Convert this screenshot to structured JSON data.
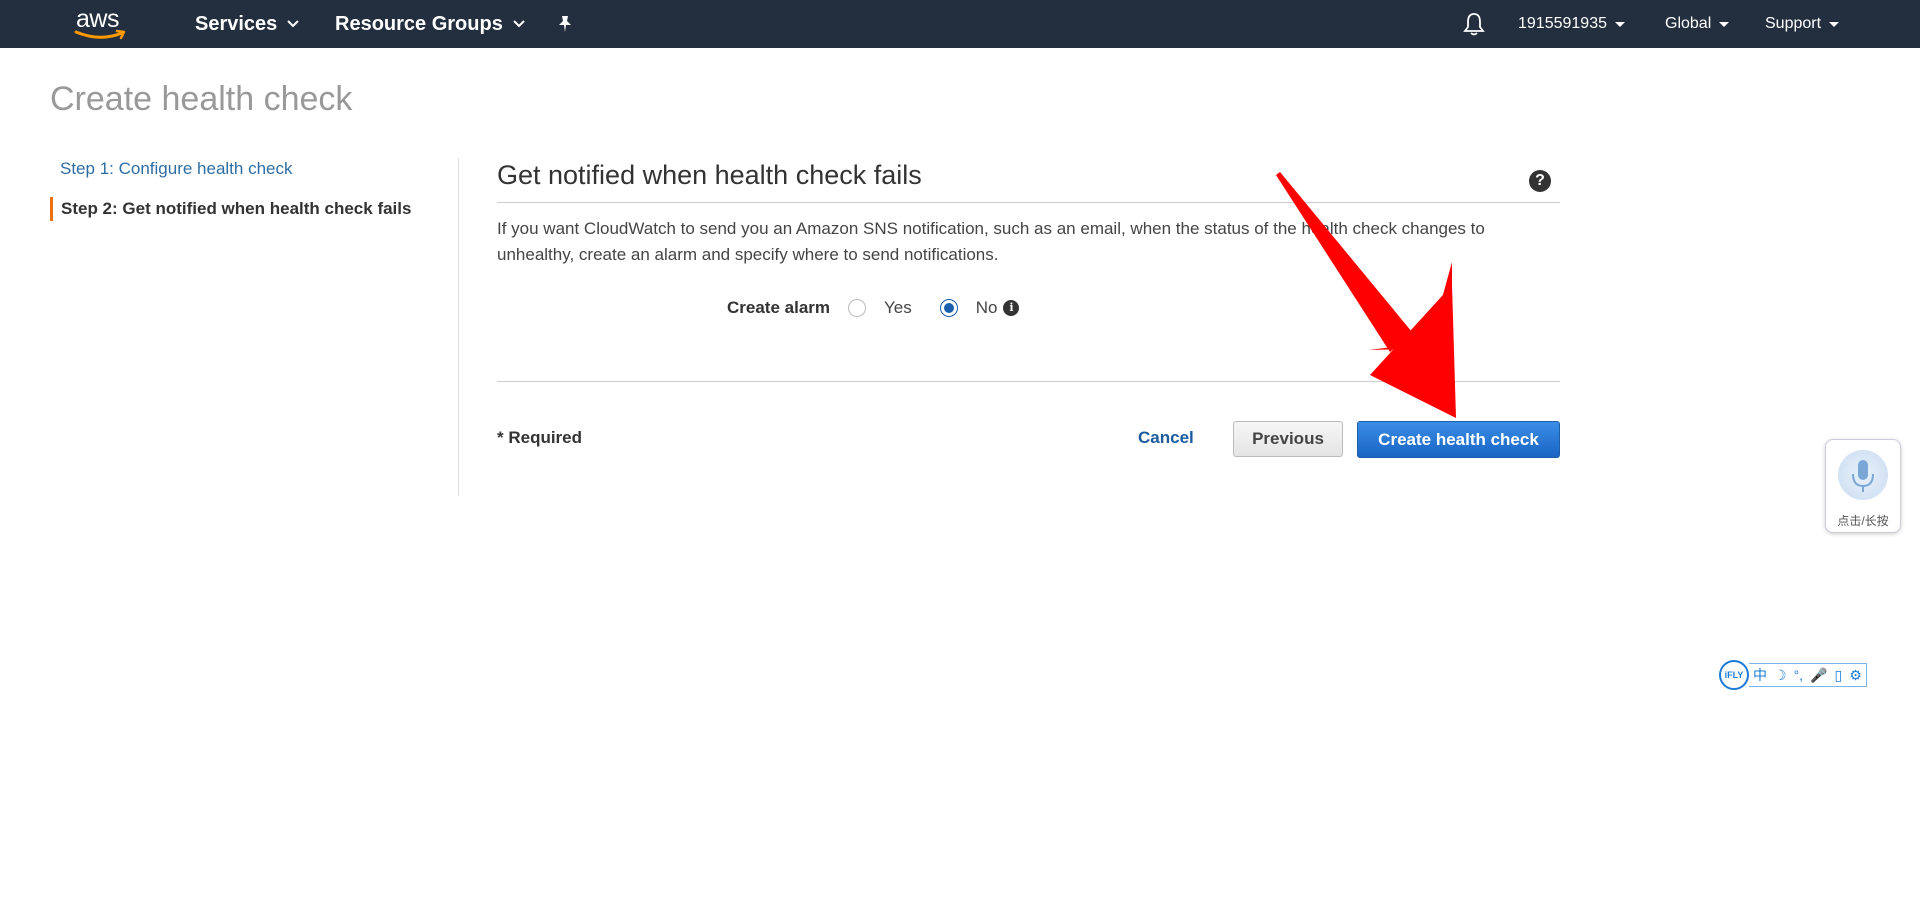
{
  "nav": {
    "logo_text": "aws",
    "services_label": "Services",
    "resource_groups_label": "Resource Groups",
    "account_label": "1915591935",
    "region_label": "Global",
    "support_label": "Support"
  },
  "page": {
    "title": "Create health check"
  },
  "steps": [
    {
      "label": "Step 1: Configure health check"
    },
    {
      "label": "Step 2: Get notified when health check fails"
    }
  ],
  "section": {
    "title": "Get notified when health check fails",
    "description": "If you want CloudWatch to send you an Amazon SNS notification, such as an email, when the status of the health check changes to unhealthy, create an alarm and specify where to send notifications.",
    "help_glyph": "?"
  },
  "alarm": {
    "label": "Create alarm",
    "yes_label": "Yes",
    "no_label": "No",
    "selected": "No",
    "info_glyph": "i"
  },
  "footer": {
    "required_text": "* Required",
    "cancel_label": "Cancel",
    "previous_label": "Previous",
    "create_label": "Create health check"
  },
  "voice_widget": {
    "label": "点击/长按"
  },
  "ifly_toolbar": {
    "logo_text": "iFLY",
    "tools": [
      "中",
      "☽",
      "°,",
      "🎤",
      "▯",
      "⚙"
    ]
  },
  "colors": {
    "nav_bg": "#232f3e",
    "link_blue": "#2e6da4",
    "primary_button": "#1a64c4",
    "step_accent": "#ec7211",
    "annotation_arrow": "#ff0000"
  }
}
